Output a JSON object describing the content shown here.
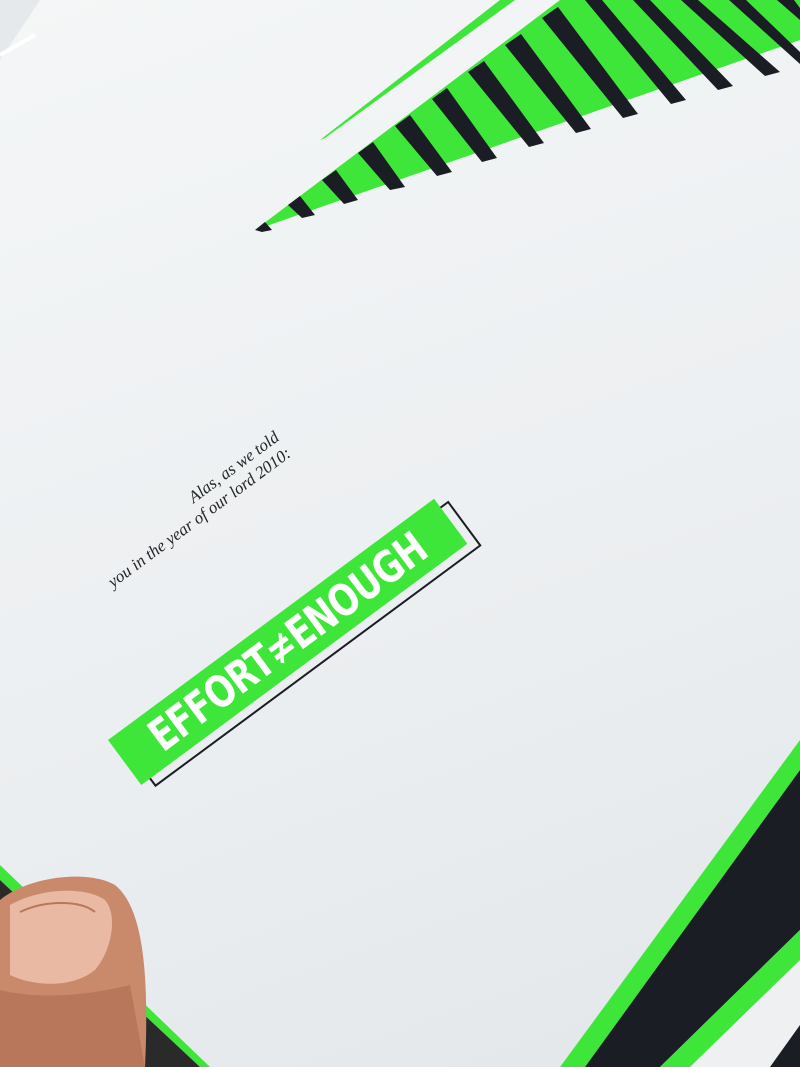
{
  "poster": {
    "caption_line1": "Alas, as we told",
    "caption_line2": "you in the year of our lord 2010:",
    "badge_text": "EFFORT≠ENOUGH"
  },
  "colors": {
    "paper": "#f2f4f5",
    "neon_green": "#3fe63a",
    "navy": "#1a1d24",
    "skin": "#d99a7a"
  }
}
